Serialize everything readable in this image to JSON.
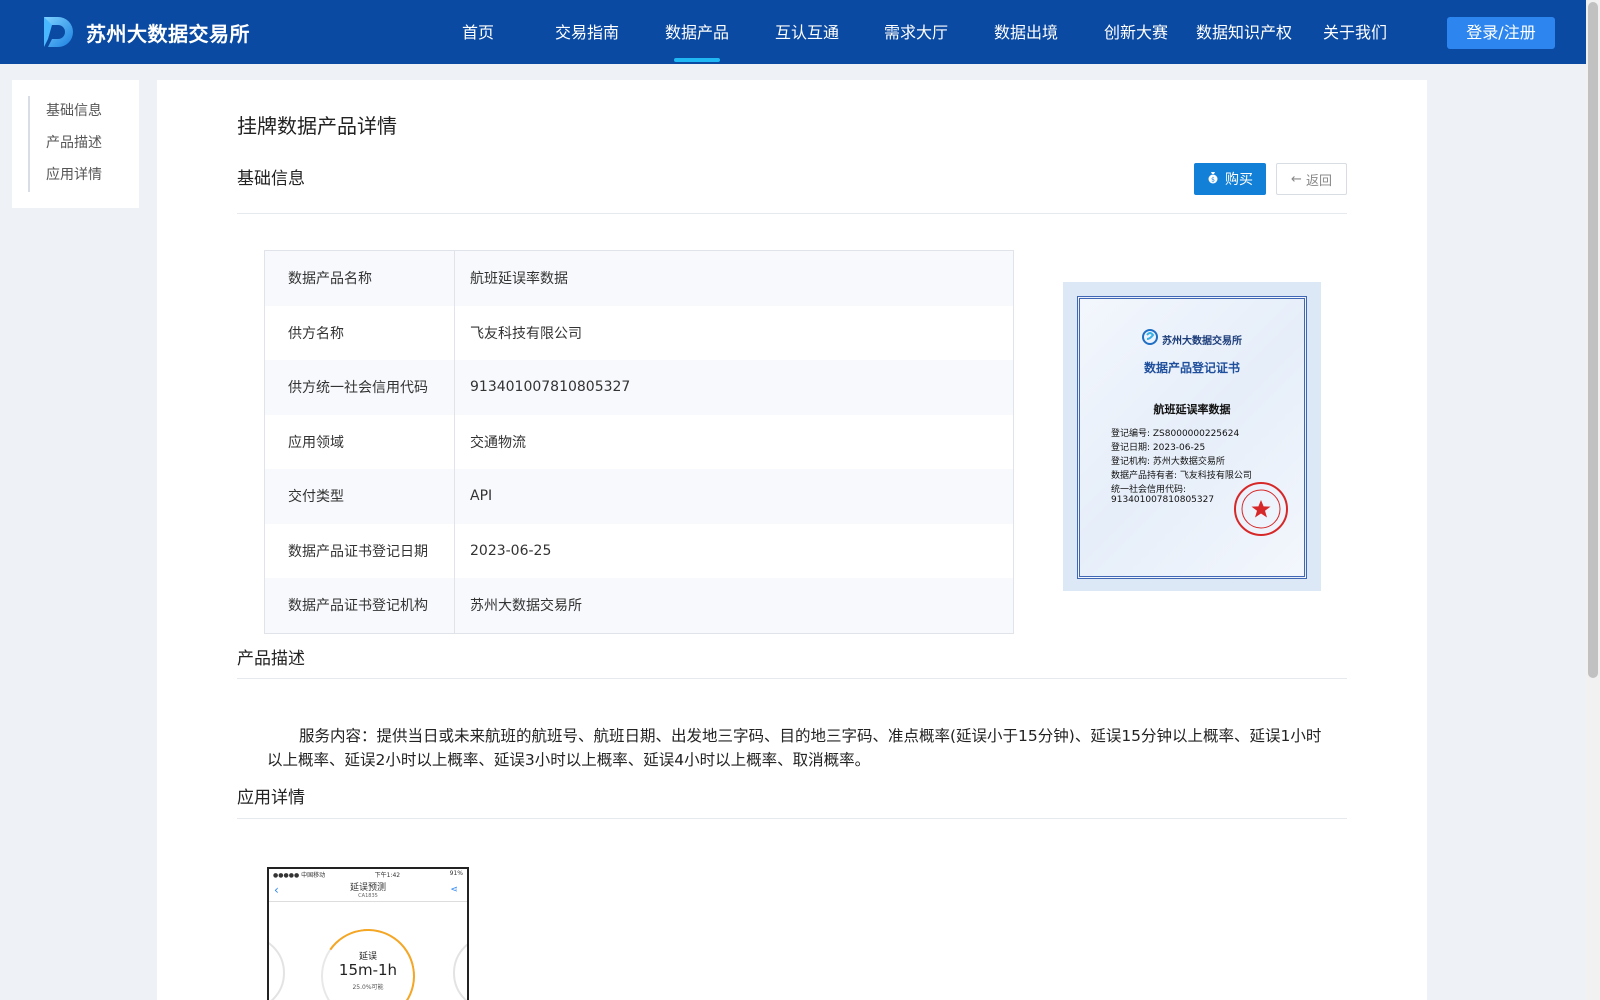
{
  "header": {
    "logo_text": "苏州大数据交易所",
    "nav": [
      "首页",
      "交易指南",
      "数据产品",
      "互认互通",
      "需求大厅",
      "数据出境",
      "创新大赛",
      "数据知识产权",
      "关于我们"
    ],
    "active_nav": "数据产品",
    "login_label": "登录/注册",
    "colors": {
      "bar": "#0b4aa2",
      "accent": "#1fb8f5",
      "login": "#2d86f0"
    }
  },
  "sidenav": {
    "items": [
      "基础信息",
      "产品描述",
      "应用详情"
    ]
  },
  "main": {
    "page_title": "挂牌数据产品详情",
    "basic_section": "基础信息",
    "buy_label": "购买",
    "back_label": "返回",
    "info_rows": [
      {
        "label": "数据产品名称",
        "value": "航班延误率数据"
      },
      {
        "label": "供方名称",
        "value": "飞友科技有限公司"
      },
      {
        "label": "供方统一社会信用代码",
        "value": "913401007810805327"
      },
      {
        "label": "应用领域",
        "value": "交通物流"
      },
      {
        "label": "交付类型",
        "value": "API"
      },
      {
        "label": "数据产品证书登记日期",
        "value": "2023-06-25"
      },
      {
        "label": "数据产品证书登记机构",
        "value": "苏州大数据交易所"
      }
    ],
    "certificate": {
      "org": "苏州大数据交易所",
      "title": "数据产品登记证书",
      "product": "航班延误率数据",
      "lines": [
        "登记编号: ZS8000000225624",
        "登记日期: 2023-06-25",
        "登记机构: 苏州大数据交易所",
        "数据产品持有者: 飞友科技有限公司",
        "统一社会信用代码:",
        "913401007810805327"
      ]
    },
    "desc_section": "产品描述",
    "description": "服务内容：提供当日或未来航班的航班号、航班日期、出发地三字码、目的地三字码、准点概率(延误小于15分钟)、延误15分钟以上概率、延误1小时以上概率、延误2小时以上概率、延误3小时以上概率、延误4小时以上概率、取消概率。",
    "app_section": "应用详情",
    "phone": {
      "carrier": "●●●●● 中国移动",
      "time": "下午1:42",
      "battery": "91%",
      "title": "延误预测",
      "flight": "CA1835",
      "gauge_label": "延误",
      "gauge_value": "15m-1h",
      "gauge_prob": "25.0%可能"
    }
  }
}
